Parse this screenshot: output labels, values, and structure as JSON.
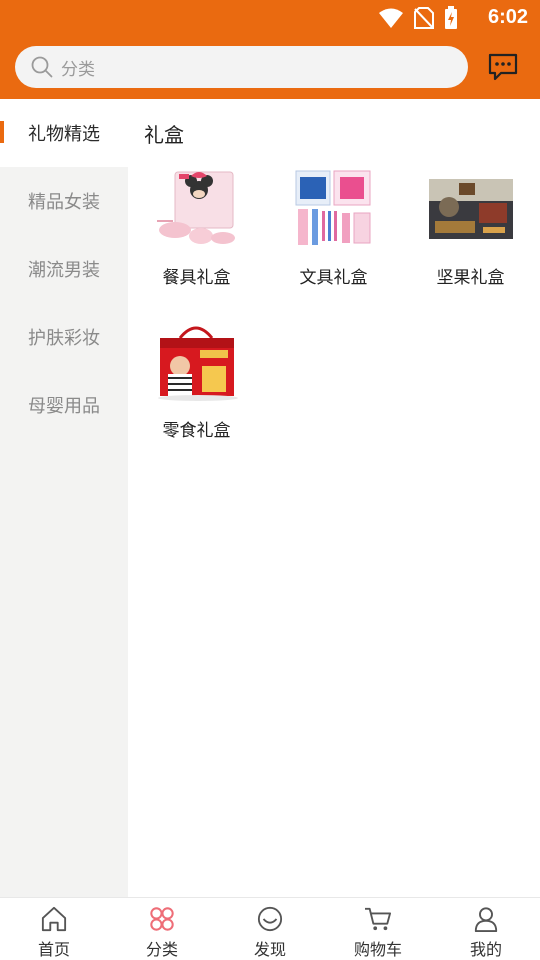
{
  "status_bar": {
    "time": "6:02"
  },
  "search": {
    "placeholder": "分类"
  },
  "sidebar": {
    "items": [
      {
        "label": "礼物精选",
        "active": true
      },
      {
        "label": "精品女装",
        "active": false
      },
      {
        "label": "潮流男装",
        "active": false
      },
      {
        "label": "护肤彩妆",
        "active": false
      },
      {
        "label": "母婴用品",
        "active": false
      }
    ]
  },
  "content": {
    "section_title": "礼盒",
    "products": [
      {
        "label": "餐具礼盒",
        "image": "minnie-tableware-gift-box"
      },
      {
        "label": "文具礼盒",
        "image": "stationery-gift-set"
      },
      {
        "label": "坚果礼盒",
        "image": "nuts-gift-box"
      },
      {
        "label": "零食礼盒",
        "image": "red-snack-gift-bag"
      }
    ]
  },
  "tabbar": {
    "tabs": [
      {
        "label": "首页",
        "icon": "home-icon"
      },
      {
        "label": "分类",
        "icon": "category-icon",
        "active": true
      },
      {
        "label": "发现",
        "icon": "discover-icon"
      },
      {
        "label": "购物车",
        "icon": "cart-icon"
      },
      {
        "label": "我的",
        "icon": "profile-icon"
      }
    ]
  },
  "colors": {
    "brand": "#ea6a10",
    "sidebar_bg": "#f3f3f2",
    "active_tab_icon": "#ee6d77"
  }
}
